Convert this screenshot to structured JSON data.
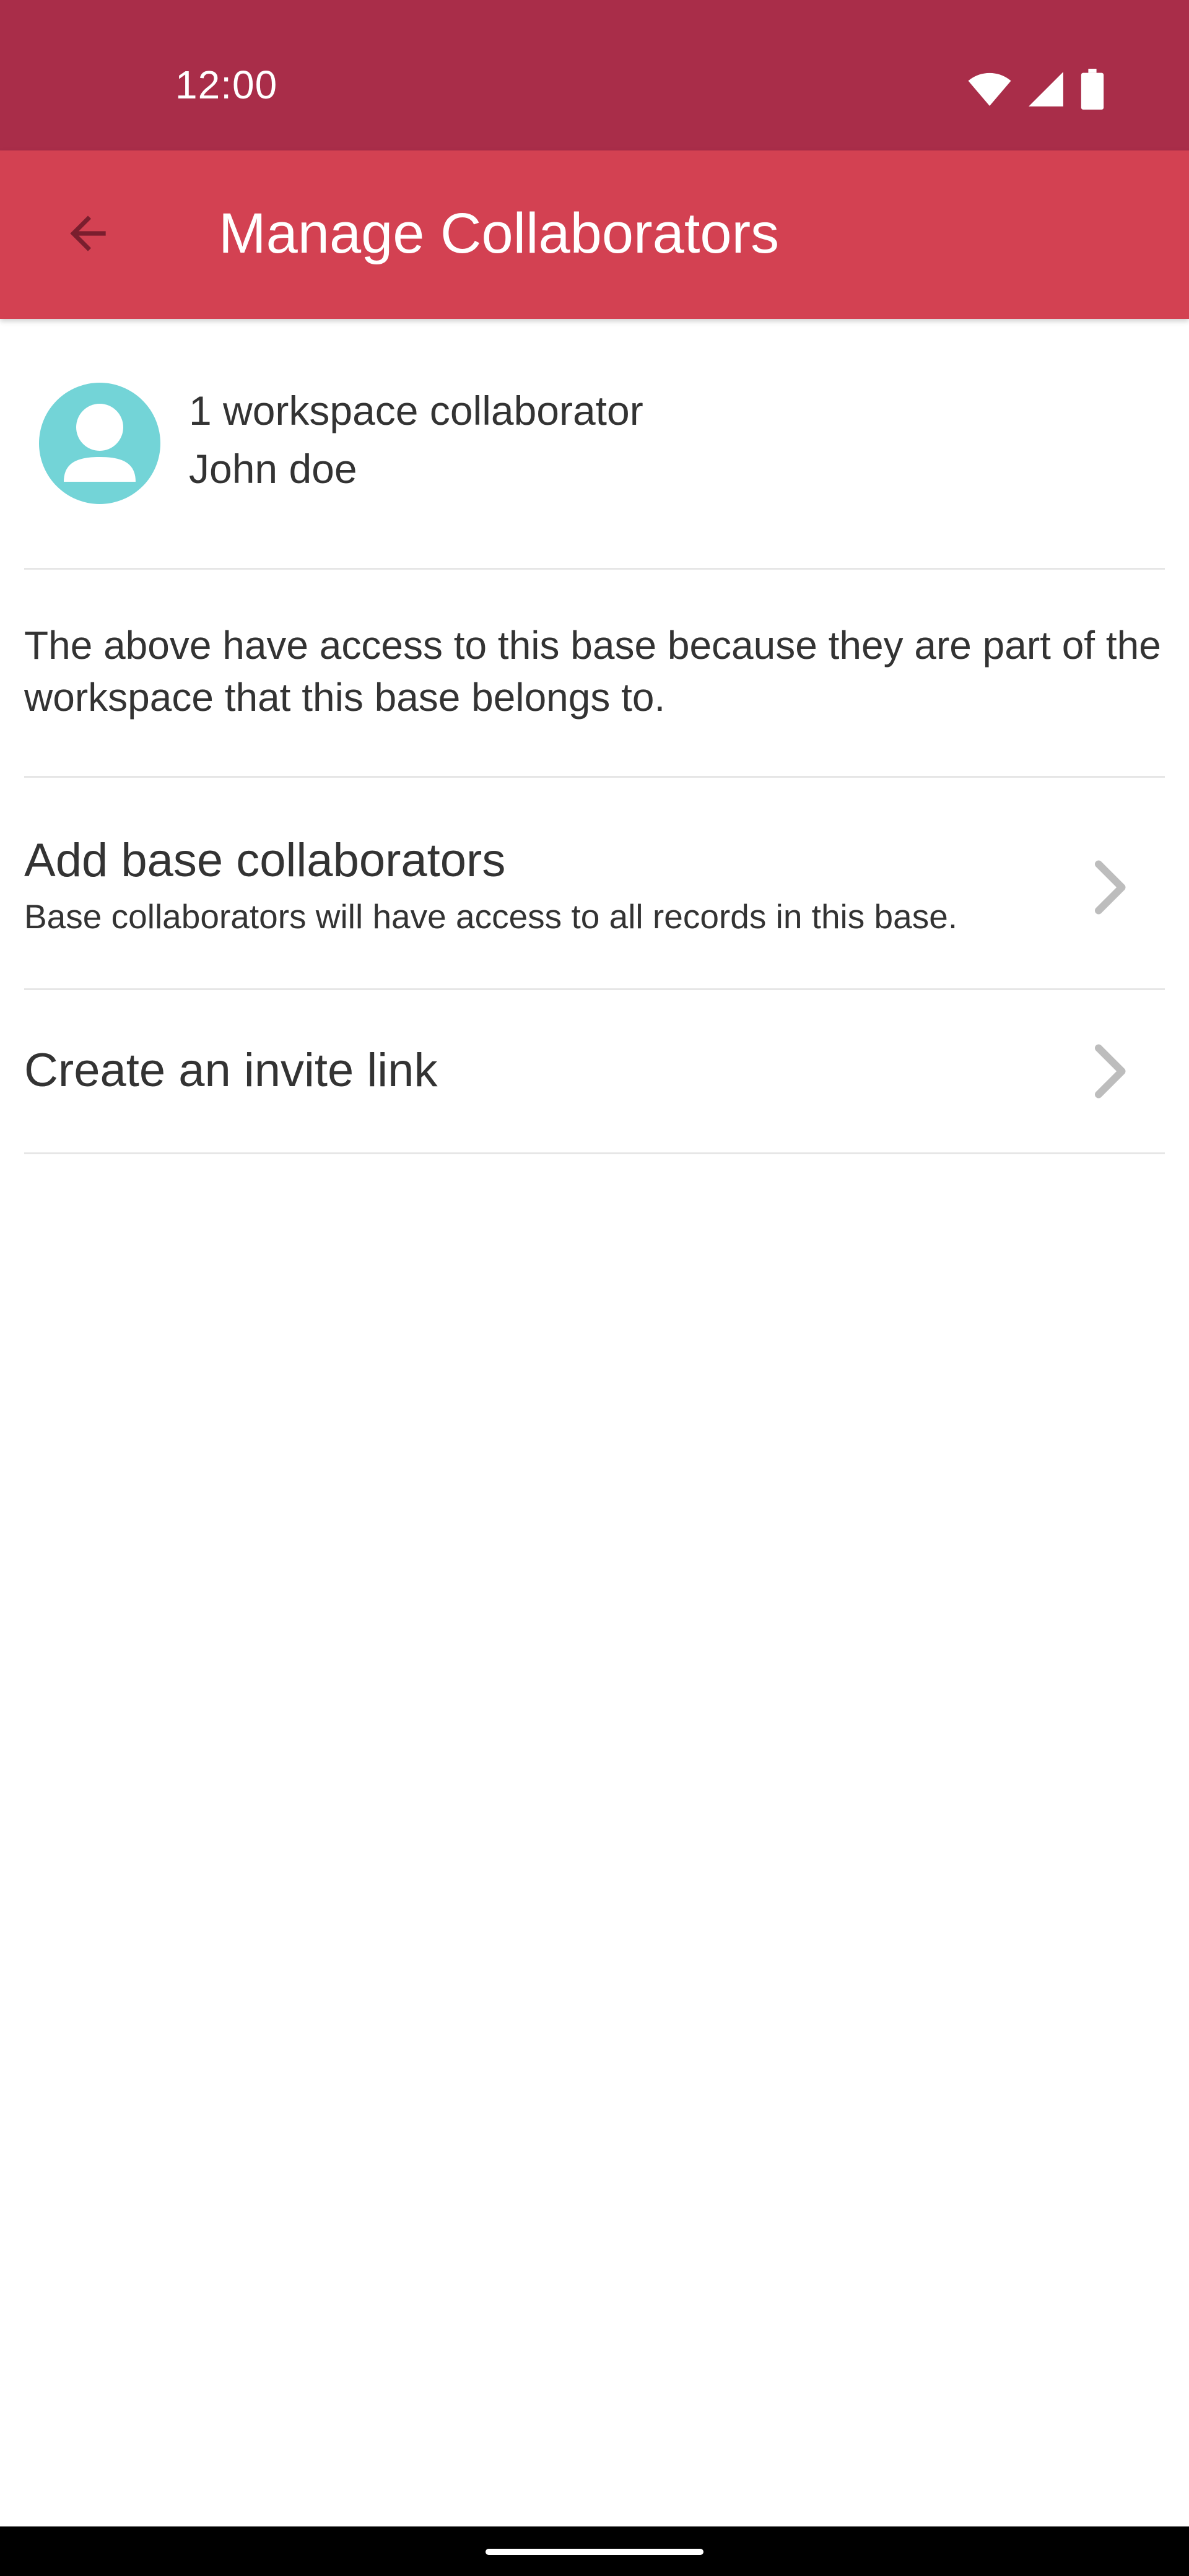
{
  "status_bar": {
    "time": "12:00",
    "icons": [
      "wifi-icon",
      "signal-icon",
      "battery-icon"
    ],
    "background": "#a92d49"
  },
  "app_bar": {
    "title": "Manage Collaborators",
    "back_icon": "arrow-back-icon",
    "background": "#d34152"
  },
  "collaborators": {
    "count_label": "1 workspace collaborator",
    "name": "John doe",
    "avatar_color": "#73d4d7"
  },
  "info": {
    "text": "The above have access to this base because they are part of the workspace that this base belongs to."
  },
  "actions": [
    {
      "title": "Add base collaborators",
      "subtitle": "Base collaborators will have access to all records in this base.",
      "icon": "chevron-right-icon"
    },
    {
      "title": "Create an invite link",
      "icon": "chevron-right-icon"
    }
  ]
}
